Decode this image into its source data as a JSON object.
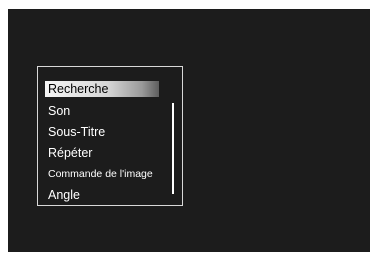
{
  "menu": {
    "items": [
      {
        "label": "Recherche",
        "selected": true
      },
      {
        "label": "Son",
        "selected": false
      },
      {
        "label": "Sous-Titre",
        "selected": false
      },
      {
        "label": "Répéter",
        "selected": false
      },
      {
        "label": "Commande de l'image",
        "selected": false
      },
      {
        "label": "Angle",
        "selected": false
      }
    ]
  },
  "colors": {
    "screen_background": "#1c1c1c",
    "menu_border": "#d8d8d8",
    "text": "#ffffff",
    "highlight": "#d6d6d6"
  }
}
